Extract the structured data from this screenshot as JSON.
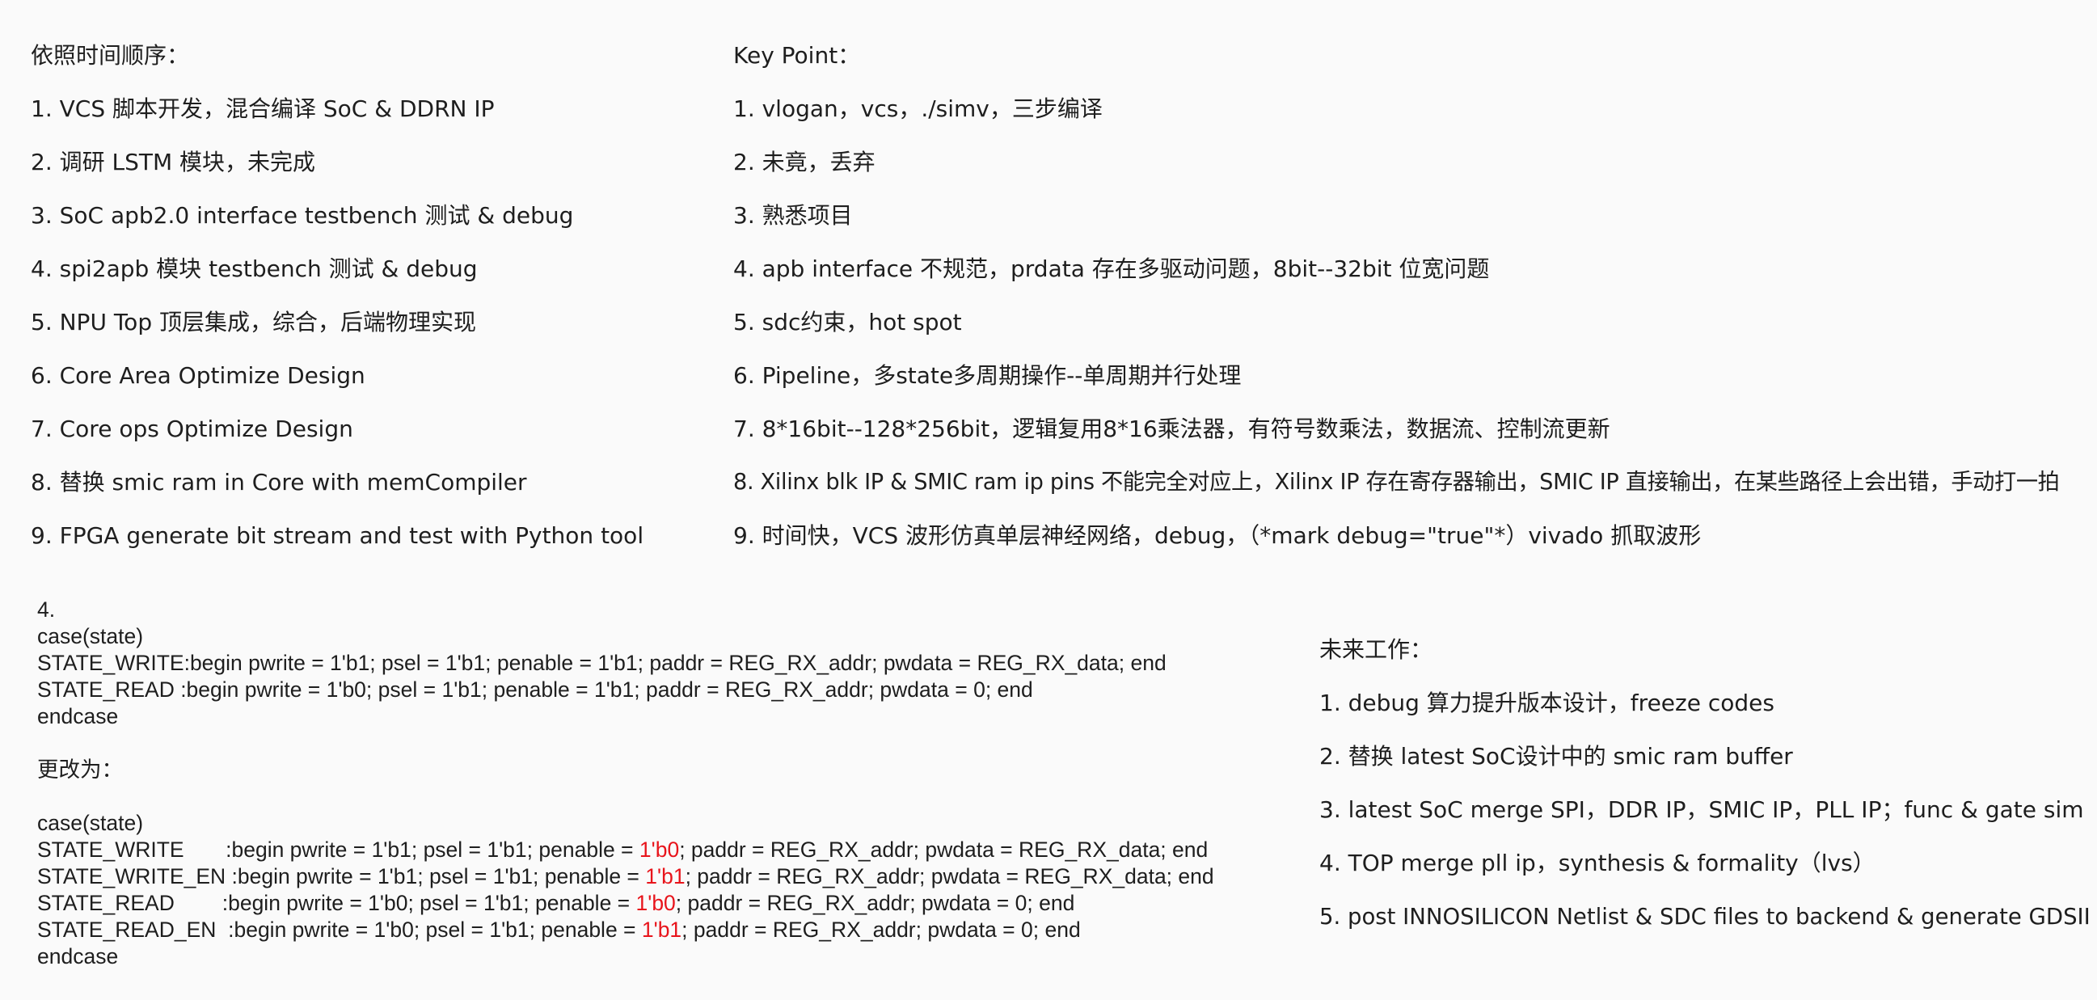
{
  "left": {
    "heading": "依照时间顺序：",
    "items": [
      "1. VCS 脚本开发，混合编译 SoC & DDRN IP",
      "2. 调研 LSTM 模块，未完成",
      "3. SoC apb2.0 interface testbench 测试 & debug",
      "4. spi2apb 模块 testbench 测试 & debug",
      "5. NPU Top 顶层集成，综合，后端物理实现",
      "6. Core Area Optimize Design",
      "7. Core ops Optimize Design",
      "8. 替换 smic ram in Core with memCompiler",
      "9. FPGA generate bit stream and test with Python tool"
    ]
  },
  "right": {
    "heading": "Key Point：",
    "items": [
      "1. vlogan，vcs，./simv，三步编译",
      "2. 未竟，丢弃",
      "3. 熟悉项目",
      "4. apb interface 不规范，prdata 存在多驱动问题，8bit--32bit 位宽问题",
      "5. sdc约束，hot spot",
      "6. Pipeline，多state多周期操作--单周期并行处理",
      "7. 8*16bit--128*256bit，逻辑复用8*16乘法器，有符号数乘法，数据流、控制流更新",
      "8. Xilinx blk IP & SMIC ram ip pins 不能完全对应上，Xilinx IP 存在寄存器输出，SMIC IP 直接输出，在某些路径上会出错，手动打一拍",
      "9. 时间快，VCS 波形仿真单层神经网络，debug，（*mark debug=\"true\"*）vivado 抓取波形"
    ]
  },
  "code": {
    "number": "4.",
    "before": {
      "case": "case(state)",
      "lines": [
        "STATE_WRITE:begin pwrite = 1'b1; psel = 1'b1; penable = 1'b1; paddr = REG_RX_addr; pwdata = REG_RX_data; end",
        "STATE_READ :begin pwrite = 1'b0; psel = 1'b1; penable = 1'b1; paddr = REG_RX_addr; pwdata = 0; end"
      ],
      "endcase": "endcase"
    },
    "change_label": "更改为：",
    "after": {
      "case": "case(state)",
      "lines": [
        {
          "pre": "STATE_WRITE       :begin pwrite = 1'b1; psel = 1'b1; penable = ",
          "hl": "1'b0",
          "post": "; paddr = REG_RX_addr; pwdata = REG_RX_data; end"
        },
        {
          "pre": "STATE_WRITE_EN :begin pwrite = 1'b1; psel = 1'b1; penable = ",
          "hl": "1'b1",
          "post": "; paddr = REG_RX_addr; pwdata = REG_RX_data; end"
        },
        {
          "pre": "STATE_READ        :begin pwrite = 1'b0; psel = 1'b1; penable = ",
          "hl": "1'b0",
          "post": "; paddr = REG_RX_addr; pwdata = 0; end"
        },
        {
          "pre": "STATE_READ_EN  :begin pwrite = 1'b0; psel = 1'b1; penable = ",
          "hl": "1'b1",
          "post": "; paddr = REG_RX_addr; pwdata = 0; end"
        }
      ],
      "endcase": "endcase"
    },
    "highlight_color": "#e8141b"
  },
  "future": {
    "heading": "未来工作：",
    "items": [
      "1. debug 算力提升版本设计，freeze codes",
      "2. 替换 latest SoC设计中的 smic ram buffer",
      "3. latest SoC merge SPI，DDR IP，SMIC IP，PLL IP；func & gate sim",
      "4. TOP merge pll ip，synthesis & formality（lvs）",
      "5. post INNOSILICON Netlist & SDC files to backend & generate GDSII"
    ]
  }
}
